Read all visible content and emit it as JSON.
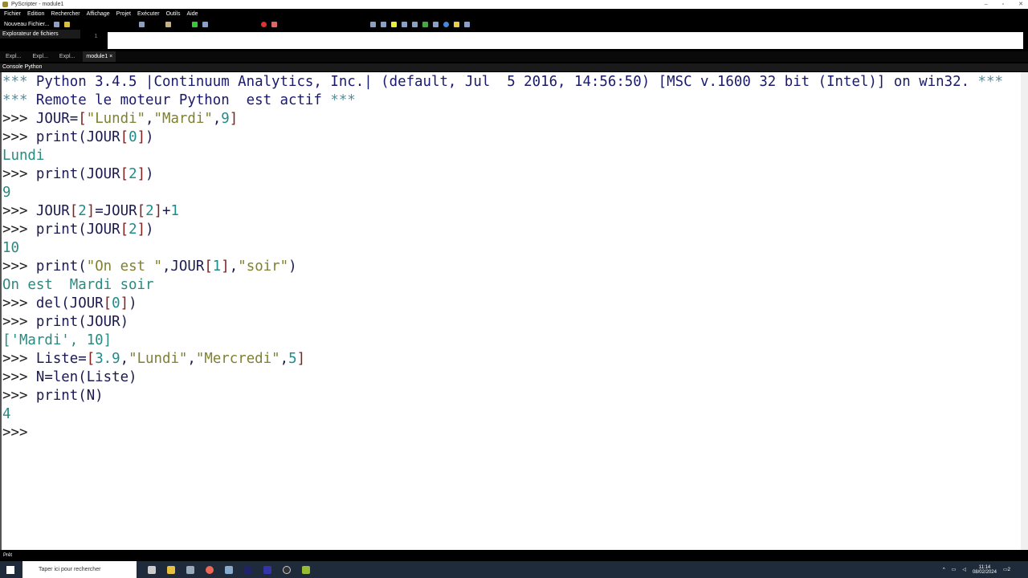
{
  "window": {
    "title": "PyScripter - module1"
  },
  "menu": [
    "Fichier",
    "Edition",
    "Rechercher",
    "Affichage",
    "Projet",
    "Exécuter",
    "Outils",
    "Aide"
  ],
  "toolbar": {
    "new_file": "Nouveau Fichier..."
  },
  "explorer": {
    "title": "Explorateur de fichiers",
    "tabs": [
      "Expl...",
      "Expl...",
      "Expl..."
    ]
  },
  "editor": {
    "line_number": "1",
    "tab": "module1"
  },
  "console": {
    "title": "Console Python",
    "lines": [
      [
        [
          "***",
          "a"
        ],
        [
          " Python 3.4.5 |Continuum Analytics, Inc.| (default, Jul  5 2016, 14:56:50) [MSC v.1600 32 bit (Intel)] on win32. ",
          "h"
        ],
        [
          "***",
          "a"
        ]
      ],
      [
        [
          "***",
          "a"
        ],
        [
          " Remote le moteur Python  est actif ",
          "h"
        ],
        [
          "***",
          "a"
        ]
      ],
      [
        [
          ">>> ",
          "p"
        ],
        [
          "JOUR=",
          "c"
        ],
        [
          "[",
          "b"
        ],
        [
          "\"Lundi\"",
          "s"
        ],
        [
          ",",
          "c"
        ],
        [
          "\"Mardi\"",
          "s"
        ],
        [
          ",",
          "c"
        ],
        [
          "9",
          "n"
        ],
        [
          "]",
          "b"
        ]
      ],
      [
        [
          ">>> ",
          "p"
        ],
        [
          "print(JOUR",
          "c"
        ],
        [
          "[",
          "b"
        ],
        [
          "0",
          "n"
        ],
        [
          "]",
          "b"
        ],
        [
          ")",
          "c"
        ]
      ],
      [
        [
          "Lundi",
          "o"
        ]
      ],
      [
        [
          ">>> ",
          "p"
        ],
        [
          "print(JOUR",
          "c"
        ],
        [
          "[",
          "b"
        ],
        [
          "2",
          "n"
        ],
        [
          "]",
          "b"
        ],
        [
          ")",
          "c"
        ]
      ],
      [
        [
          "9",
          "o"
        ]
      ],
      [
        [
          ">>> ",
          "p"
        ],
        [
          "JOUR",
          "c"
        ],
        [
          "[",
          "b"
        ],
        [
          "2",
          "n"
        ],
        [
          "]",
          "b"
        ],
        [
          "=JOUR",
          "c"
        ],
        [
          "[",
          "b"
        ],
        [
          "2",
          "n"
        ],
        [
          "]",
          "b"
        ],
        [
          "+",
          "c"
        ],
        [
          "1",
          "n"
        ]
      ],
      [
        [
          ">>> ",
          "p"
        ],
        [
          "print(JOUR",
          "c"
        ],
        [
          "[",
          "b"
        ],
        [
          "2",
          "n"
        ],
        [
          "]",
          "b"
        ],
        [
          ")",
          "c"
        ]
      ],
      [
        [
          "10",
          "o"
        ]
      ],
      [
        [
          ">>> ",
          "p"
        ],
        [
          "print(",
          "c"
        ],
        [
          "\"On est \"",
          "s"
        ],
        [
          ",JOUR",
          "c"
        ],
        [
          "[",
          "b"
        ],
        [
          "1",
          "n"
        ],
        [
          "]",
          "b"
        ],
        [
          ",",
          "c"
        ],
        [
          "\"soir\"",
          "s"
        ],
        [
          ")",
          "c"
        ]
      ],
      [
        [
          "On est  Mardi soir",
          "o"
        ]
      ],
      [
        [
          ">>> ",
          "p"
        ],
        [
          "del(JOUR",
          "c"
        ],
        [
          "[",
          "b"
        ],
        [
          "0",
          "n"
        ],
        [
          "]",
          "b"
        ],
        [
          ")",
          "c"
        ]
      ],
      [
        [
          ">>> ",
          "p"
        ],
        [
          "print(JOUR)",
          "c"
        ]
      ],
      [
        [
          "['Mardi', 10]",
          "o"
        ]
      ],
      [
        [
          ">>> ",
          "p"
        ],
        [
          "Liste=",
          "c"
        ],
        [
          "[",
          "b"
        ],
        [
          "3.9",
          "n"
        ],
        [
          ",",
          "c"
        ],
        [
          "\"Lundi\"",
          "s"
        ],
        [
          ",",
          "c"
        ],
        [
          "\"Mercredi\"",
          "s"
        ],
        [
          ",",
          "c"
        ],
        [
          "5",
          "n"
        ],
        [
          "]",
          "b"
        ]
      ],
      [
        [
          ">>> ",
          "p"
        ],
        [
          "N=len(Liste)",
          "c"
        ]
      ],
      [
        [
          ">>> ",
          "p"
        ],
        [
          "print(N)",
          "c"
        ]
      ],
      [
        [
          "4",
          "o"
        ]
      ],
      [
        [
          ">>>",
          "p"
        ]
      ]
    ]
  },
  "status": {
    "text": "Prêt"
  },
  "taskbar": {
    "search_placeholder": "Taper ici pour rechercher",
    "time": "11:14",
    "date": "08/02/2024",
    "notifications": "2"
  }
}
